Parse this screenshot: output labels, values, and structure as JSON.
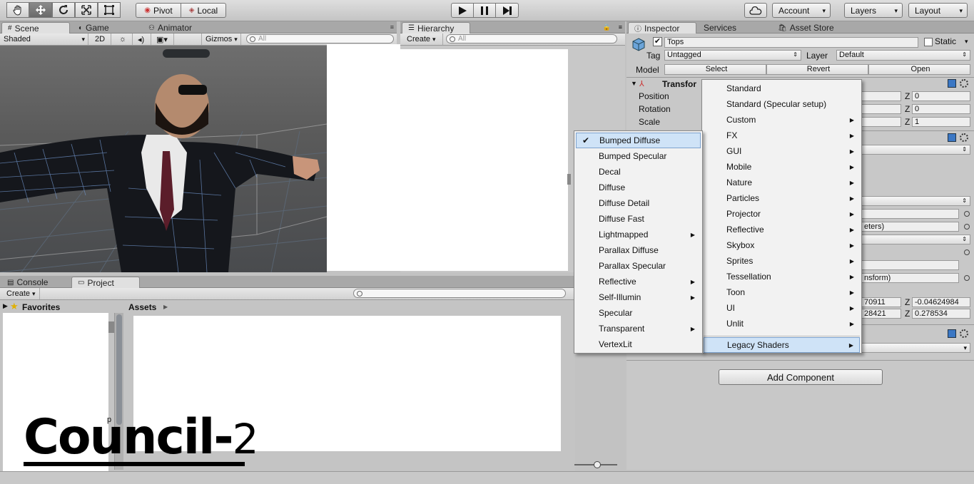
{
  "toolbar": {
    "pivot": "Pivot",
    "local": "Local",
    "account": "Account",
    "layers": "Layers",
    "layout": "Layout"
  },
  "scene": {
    "tabs": [
      "Scene",
      "Game",
      "Animator"
    ],
    "shading": "Shaded",
    "mode_2d": "2D",
    "gizmos": "Gizmos",
    "search_placeholder": "All"
  },
  "hierarchy": {
    "tab": "Hierarchy",
    "create": "Create",
    "search_placeholder": "All"
  },
  "inspector": {
    "tabs": [
      "Inspector",
      "Services",
      "Asset Store"
    ],
    "object_name": "Tops",
    "static_label": "Static",
    "tag_label": "Tag",
    "tag_value": "Untagged",
    "layer_label": "Layer",
    "layer_value": "Default",
    "model_label": "Model",
    "model_buttons": [
      "Select",
      "Revert",
      "Open"
    ],
    "transform_title": "Transfor",
    "transform_rows": [
      {
        "label": "Position",
        "z_label": "Z",
        "z": "0"
      },
      {
        "label": "Rotation",
        "z_label": "Z",
        "z": "0"
      },
      {
        "label": "Scale",
        "z_label": "Z",
        "z": "1"
      }
    ],
    "partial_texts": [
      "eters)",
      "nsform)"
    ],
    "vec_rows": [
      {
        "y_partial": "70911",
        "z_label": "Z",
        "z": "-0.04624984"
      },
      {
        "y_partial": "28421",
        "z_label": "Z",
        "z": "0.278534"
      }
    ],
    "add_component": "Add Component"
  },
  "bottom": {
    "tabs": [
      "Console",
      "Project"
    ],
    "create": "Create",
    "favorites": "Favorites",
    "assets": "Assets",
    "partial_char": "p"
  },
  "watermark": {
    "text": "Council-",
    "number": "2"
  },
  "shader_menu": {
    "items": [
      {
        "label": "Standard",
        "sub": false
      },
      {
        "label": "Standard (Specular setup)",
        "sub": false
      },
      {
        "label": "Custom",
        "sub": true
      },
      {
        "label": "FX",
        "sub": true
      },
      {
        "label": "GUI",
        "sub": true
      },
      {
        "label": "Mobile",
        "sub": true
      },
      {
        "label": "Nature",
        "sub": true
      },
      {
        "label": "Particles",
        "sub": true
      },
      {
        "label": "Projector",
        "sub": true
      },
      {
        "label": "Reflective",
        "sub": true
      },
      {
        "label": "Skybox",
        "sub": true
      },
      {
        "label": "Sprites",
        "sub": true
      },
      {
        "label": "Tessellation",
        "sub": true
      },
      {
        "label": "Toon",
        "sub": true
      },
      {
        "label": "UI",
        "sub": true
      },
      {
        "label": "Unlit",
        "sub": true
      }
    ],
    "legacy": {
      "label": "Legacy Shaders",
      "sub": true
    }
  },
  "legacy_menu": {
    "checked": "Bumped Diffuse",
    "items": [
      {
        "label": "Bumped Diffuse",
        "sub": false
      },
      {
        "label": "Bumped Specular",
        "sub": false
      },
      {
        "label": "Decal",
        "sub": false
      },
      {
        "label": "Diffuse",
        "sub": false
      },
      {
        "label": "Diffuse Detail",
        "sub": false
      },
      {
        "label": "Diffuse Fast",
        "sub": false
      },
      {
        "label": "Lightmapped",
        "sub": true
      },
      {
        "label": "Parallax Diffuse",
        "sub": false
      },
      {
        "label": "Parallax Specular",
        "sub": false
      },
      {
        "label": "Reflective",
        "sub": true
      },
      {
        "label": "Self-Illumin",
        "sub": true
      },
      {
        "label": "Specular",
        "sub": false
      },
      {
        "label": "Transparent",
        "sub": true
      },
      {
        "label": "VertexLit",
        "sub": false
      }
    ]
  },
  "icons": {
    "submenu": "▶",
    "check": "✔",
    "dropdown": "▾"
  }
}
